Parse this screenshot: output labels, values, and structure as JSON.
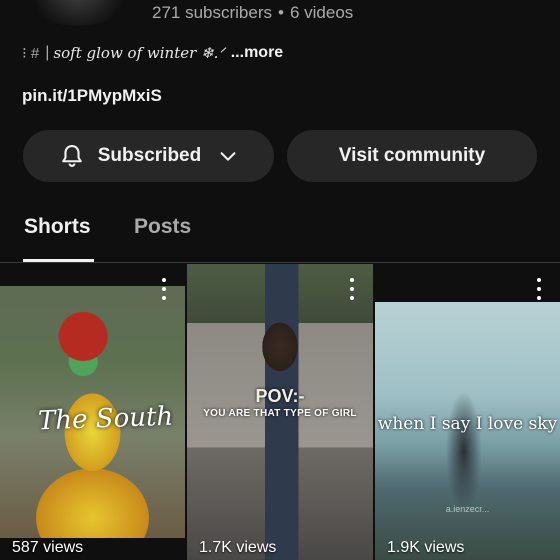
{
  "channel": {
    "subscribers": "271 subscribers",
    "separator": "•",
    "videos": "6 videos",
    "description": {
      "prefix": "⁝ #",
      "pipe": "|",
      "text": "soft glow of winter ❄.ᐟ",
      "more": "...more"
    },
    "link": "pin.it/1PMypMxiS"
  },
  "buttons": {
    "subscribed": "Subscribed",
    "visit_community": "Visit community"
  },
  "tabs": [
    {
      "label": "Shorts",
      "active": true
    },
    {
      "label": "Posts",
      "active": false
    }
  ],
  "shorts": [
    {
      "views": "587 views",
      "caption": "The South",
      "caption_sub": ""
    },
    {
      "views": "1.7K views",
      "caption": "POV:-",
      "caption_sub": "YOU ARE THAT TYPE OF GIRL"
    },
    {
      "views": "1.9K views",
      "caption": "when I say I love sky",
      "caption_sub": "a.ienzecr..."
    }
  ],
  "icons": {
    "bell": "bell-icon",
    "chevron": "chevron-down-icon",
    "more": "more-vert-icon"
  },
  "colors": {
    "background": "#0f0f0f",
    "button_bg": "#272727",
    "text_primary": "#f1f1f1",
    "text_secondary": "#aaaaaa"
  }
}
